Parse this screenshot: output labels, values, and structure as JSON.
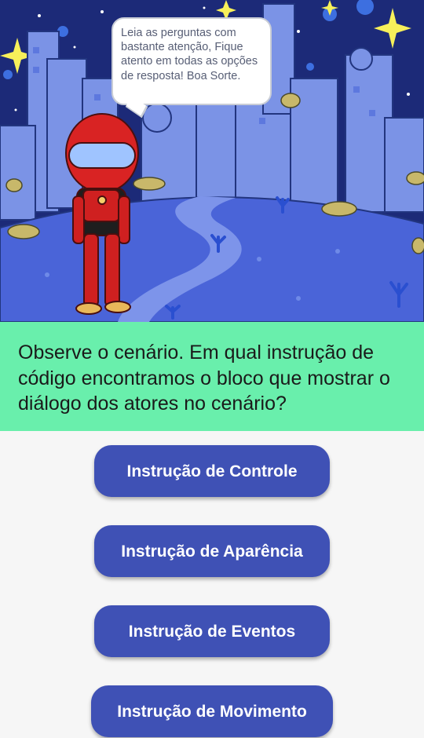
{
  "scene": {
    "speech_bubble": "Leia as perguntas com bastante atenção, Fique atento em todas as opções de resposta! Boa Sorte."
  },
  "question": {
    "text": "Observe o cenário. Em qual instrução de código encontramos o bloco que mostrar o diálogo dos atores no cenário?"
  },
  "answers": [
    {
      "label": "Instrução de Controle"
    },
    {
      "label": "Instrução de Aparência"
    },
    {
      "label": "Instrução de Eventos"
    },
    {
      "label": "Instrução de Movimento"
    }
  ],
  "colors": {
    "question_background": "#69efac",
    "button": "#3f51b5",
    "button_text": "#ffffff",
    "sky": "#1c2a78",
    "planet": "#4a64d8"
  }
}
